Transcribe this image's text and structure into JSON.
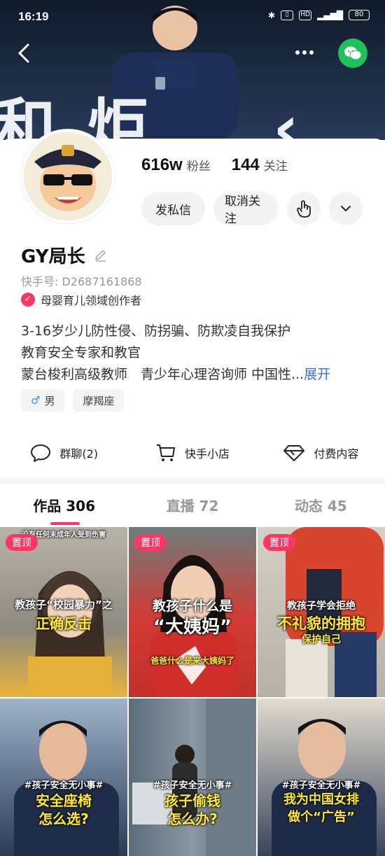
{
  "status": {
    "time": "16:19",
    "battery": "80"
  },
  "profile": {
    "name": "GY局长",
    "kuaishou_id": "快手号: D2687161868",
    "creator": "母婴育儿领域创作者",
    "followers_num": "616w",
    "followers_label": "粉丝",
    "following_num": "144",
    "following_label": "关注",
    "bio": [
      "3-16岁少儿防性侵、防拐骗、防欺凌自我保护",
      "教育安全专家和教官",
      "蒙台梭利高级教师　青少年心理咨询师 中国性..."
    ],
    "expand_label": "展开",
    "tags": [
      {
        "icon": "male-icon",
        "label": "男"
      },
      {
        "label": "摩羯座"
      }
    ]
  },
  "actions": {
    "message": "发私信",
    "unfollow": "取消关注"
  },
  "tools": [
    {
      "label": "群聊(2)",
      "icon": "chat-icon"
    },
    {
      "label": "快手小店",
      "icon": "cart-icon"
    },
    {
      "label": "付费内容",
      "icon": "diamond-icon"
    }
  ],
  "tabs": [
    {
      "label": "作品 306"
    },
    {
      "label": "直播 72"
    },
    {
      "label": "动态 45"
    }
  ],
  "pinned_label": "置顶",
  "videos": [
    {
      "top_text": "没有任何未成年人受到伤害",
      "line1": "教孩子“校园暴力”之",
      "line2": "正确反击",
      "bg": "#cfc6b8"
    },
    {
      "line1": "教孩子什么是",
      "line2": "“大姨妈”",
      "sub": "爸爸什么是来大姨妈了",
      "bg": "#d23a34"
    },
    {
      "line1": "教孩子学会拒绝",
      "line2": "不礼貌的拥抱",
      "sub": "保护自己",
      "bg": "#c94a3a"
    },
    {
      "hashtag": "#孩子安全无小事#",
      "line1": "安全座椅",
      "line2": "怎么选?",
      "bg": "#2b3a55"
    },
    {
      "hashtag": "#孩子安全无小事#",
      "line1": "孩子偷钱",
      "line2": "怎么办?",
      "bg": "#5c6b78"
    },
    {
      "hashtag": "#孩子安全无小事#",
      "line1": "我为中国女排",
      "line2": "做个“广告”",
      "bg": "#34405a"
    }
  ],
  "colors": {
    "accent": "#fe3666",
    "wechat": "#21c15a",
    "link": "#3a6fd8"
  }
}
